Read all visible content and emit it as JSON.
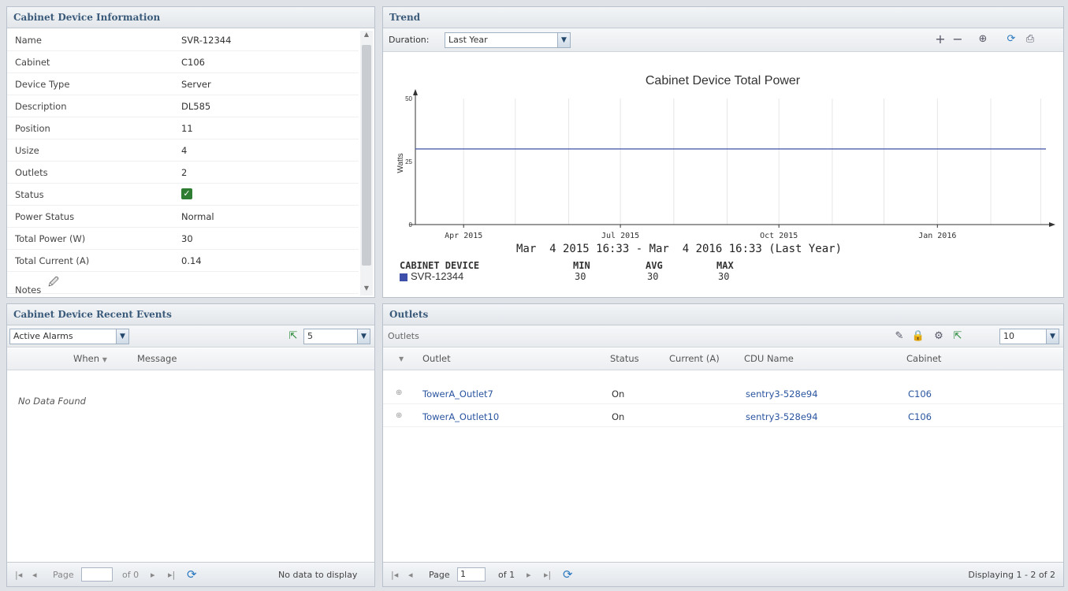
{
  "info_panel": {
    "title": "Cabinet Device Information",
    "rows": [
      {
        "label": "Name",
        "value": "SVR-12344"
      },
      {
        "label": "Cabinet",
        "value": "C106"
      },
      {
        "label": "Device Type",
        "value": "Server"
      },
      {
        "label": "Description",
        "value": "DL585"
      },
      {
        "label": "Position",
        "value": "11"
      },
      {
        "label": "Usize",
        "value": "4"
      },
      {
        "label": "Outlets",
        "value": "2"
      },
      {
        "label": "Status",
        "value": ""
      },
      {
        "label": "Power Status",
        "value": "Normal"
      },
      {
        "label": "Total Power (W)",
        "value": "30"
      },
      {
        "label": "Total Current (A)",
        "value": "0.14"
      },
      {
        "label": "Notes",
        "value": ""
      }
    ]
  },
  "trend": {
    "title": "Trend",
    "duration_label": "Duration:",
    "duration_value": "Last Year",
    "chart_title": "Cabinet Device Total Power",
    "range_text": "Mar  4 2015 16:33 - Mar  4 2016 16:33 (Last Year)",
    "stats_header": {
      "device": "CABINET DEVICE",
      "min": "MIN",
      "avg": "AVG",
      "max": "MAX"
    },
    "stats_row": {
      "device": "SVR-12344",
      "min": "30",
      "avg": "30",
      "max": "30"
    }
  },
  "chart_data": {
    "type": "line",
    "title": "Cabinet Device Total Power",
    "ylabel": "Watts",
    "xlabel": "",
    "ylim": [
      0,
      50
    ],
    "yticks": [
      "0",
      "25",
      "50"
    ],
    "xticks": [
      "Apr 2015",
      "Jul 2015",
      "Oct 2015",
      "Jan 2016"
    ],
    "series": [
      {
        "name": "SVR-12344",
        "color": "#3d4fa8",
        "x": [
          "Mar 4 2015",
          "Mar 4 2016"
        ],
        "values": [
          30,
          30
        ]
      }
    ],
    "grid": true
  },
  "events_panel": {
    "title": "Cabinet Device Recent Events",
    "filter_value": "Active Alarms",
    "page_size": "5",
    "columns": {
      "when": "When",
      "message": "Message"
    },
    "empty_text": "No Data Found",
    "pager": {
      "page_label": "Page",
      "page_value": "",
      "of_text": "of 0",
      "status": "No data to display"
    }
  },
  "outlets_panel": {
    "title": "Outlets",
    "toolbar_label": "Outlets",
    "page_size": "10",
    "columns": {
      "outlet": "Outlet",
      "status": "Status",
      "current": "Current (A)",
      "cdu": "CDU Name",
      "cabinet": "Cabinet"
    },
    "rows": [
      {
        "outlet": "TowerA_Outlet7",
        "status": "On",
        "current": "",
        "cdu": "sentry3-528e94",
        "cabinet": "C106"
      },
      {
        "outlet": "TowerA_Outlet10",
        "status": "On",
        "current": "",
        "cdu": "sentry3-528e94",
        "cabinet": "C106"
      }
    ],
    "pager": {
      "page_label": "Page",
      "page_value": "1",
      "of_text": "of 1",
      "status": "Displaying 1 - 2 of 2"
    }
  },
  "colors": {
    "accent": "#2b55a0",
    "header_text": "#3a5a7a",
    "series": "#3d4fa8",
    "status_ok": "#2e7d32"
  }
}
